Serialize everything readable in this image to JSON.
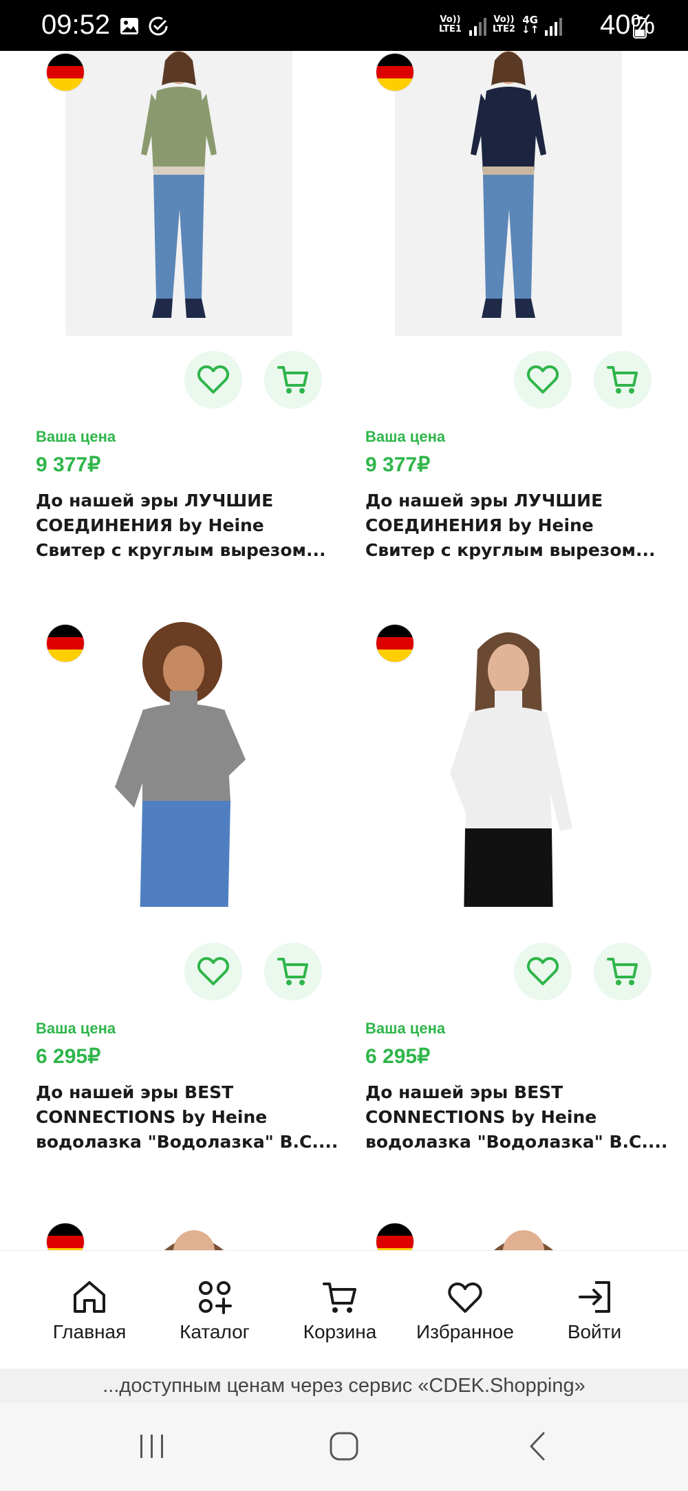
{
  "status_bar": {
    "time": "09:52",
    "sim1_line1": "Vo))",
    "sim1_line2": "LTE1",
    "sim2_line1": "Vo))",
    "sim2_line2": "LTE2",
    "net_type": "4G",
    "battery": "40%",
    "icons": [
      "gallery-icon",
      "check-circle-icon",
      "signal-icon",
      "battery-icon"
    ]
  },
  "products": [
    {
      "country_flag": "germany-flag",
      "price_label": "Ваша цена",
      "price": "9 377₽",
      "title_lines": [
        "До нашей эры ЛУЧШИЕ",
        "СОЕДИНЕНИЯ by Heine",
        "Свитер с круглым вырезом..."
      ],
      "image": "woman-olive-sweater-jeans"
    },
    {
      "country_flag": "germany-flag",
      "price_label": "Ваша цена",
      "price": "9 377₽",
      "title_lines": [
        "До нашей эры ЛУЧШИЕ",
        "СОЕДИНЕНИЯ by Heine",
        "Свитер с круглым вырезом..."
      ],
      "image": "woman-navy-sweater-jeans"
    },
    {
      "country_flag": "germany-flag",
      "price_label": "Ваша цена",
      "price": "6 295₽",
      "title_lines": [
        "До нашей эры BEST",
        "CONNECTIONS by Heine",
        "водолазка \"Водолазка\" B.C...."
      ],
      "image": "woman-grey-turtleneck"
    },
    {
      "country_flag": "germany-flag",
      "price_label": "Ваша цена",
      "price": "6 295₽",
      "title_lines": [
        "До нашей эры BEST",
        "CONNECTIONS by Heine",
        "водолазка \"Водолазка\" B.C...."
      ],
      "image": "woman-white-turtleneck"
    }
  ],
  "bottom_nav": [
    {
      "label": "Главная",
      "icon": "home-icon"
    },
    {
      "label": "Каталог",
      "icon": "catalog-icon"
    },
    {
      "label": "Корзина",
      "icon": "cart-icon"
    },
    {
      "label": "Избранное",
      "icon": "heart-icon"
    },
    {
      "label": "Войти",
      "icon": "login-icon"
    }
  ],
  "banner": "...доступным ценам через сервис «CDEK.Shopping»",
  "colors": {
    "accent_green": "#2fb54a",
    "button_bg": "#eaf8ee",
    "text": "#1a1a1a"
  }
}
